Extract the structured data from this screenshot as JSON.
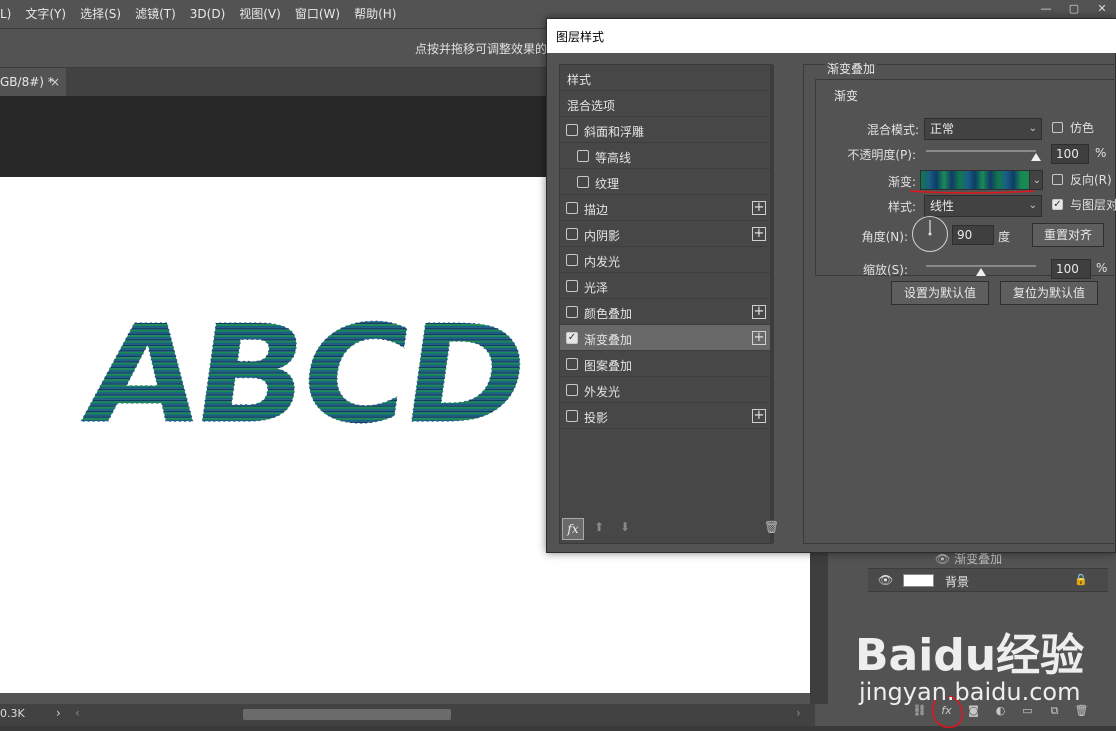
{
  "menubar": {
    "items": [
      "L)",
      "文字(Y)",
      "选择(S)",
      "滤镜(T)",
      "3D(D)",
      "视图(V)",
      "窗口(W)",
      "帮助(H)"
    ]
  },
  "options_bar": {
    "hint": "点按并拖移可调整效果的"
  },
  "document": {
    "tab_label": "GB/8#) *",
    "close_glyph": "×",
    "artwork_text": "ABCD",
    "gradient_colors": [
      "#0f7a4a",
      "#1c5f86",
      "#0b3d66",
      "#1a8a55",
      "#123a6a"
    ]
  },
  "status": {
    "zoom": "0.3K"
  },
  "layers": {
    "fx_label": "渐变叠加",
    "background_name": "背景"
  },
  "dialog": {
    "title": "图层样式",
    "style_list": {
      "header": "样式",
      "blend_options": "混合选项",
      "items": [
        {
          "label": "斜面和浮雕",
          "checked": false,
          "plus": false,
          "indent": false
        },
        {
          "label": "等高线",
          "checked": false,
          "plus": false,
          "indent": true
        },
        {
          "label": "纹理",
          "checked": false,
          "plus": false,
          "indent": true
        },
        {
          "label": "描边",
          "checked": false,
          "plus": true,
          "indent": false
        },
        {
          "label": "内阴影",
          "checked": false,
          "plus": true,
          "indent": false
        },
        {
          "label": "内发光",
          "checked": false,
          "plus": false,
          "indent": false
        },
        {
          "label": "光泽",
          "checked": false,
          "plus": false,
          "indent": false
        },
        {
          "label": "颜色叠加",
          "checked": false,
          "plus": true,
          "indent": false
        },
        {
          "label": "渐变叠加",
          "checked": true,
          "plus": true,
          "indent": false,
          "selected": true
        },
        {
          "label": "图案叠加",
          "checked": false,
          "plus": false,
          "indent": false
        },
        {
          "label": "外发光",
          "checked": false,
          "plus": false,
          "indent": false
        },
        {
          "label": "投影",
          "checked": false,
          "plus": true,
          "indent": false
        }
      ],
      "fx_glyph": "fx"
    },
    "settings": {
      "section_title": "渐变叠加",
      "group_title": "渐变",
      "blend_mode_label": "混合模式:",
      "blend_mode_value": "正常",
      "dither_label": "仿色",
      "dither_checked": false,
      "opacity_label": "不透明度(P):",
      "opacity_value": "100",
      "opacity_fraction": 1.0,
      "gradient_label": "渐变:",
      "reverse_label": "反向(R)",
      "reverse_checked": false,
      "style_label": "样式:",
      "style_value": "线性",
      "align_label": "与图层对齐",
      "align_checked": true,
      "angle_label": "角度(N):",
      "angle_value": "90",
      "angle_unit": "度",
      "reset_align_button": "重置对齐",
      "scale_label": "缩放(S):",
      "scale_value": "100",
      "scale_fraction": 0.5,
      "percent": "%",
      "make_default_button": "设置为默认值",
      "reset_default_button": "复位为默认值"
    }
  },
  "watermark": {
    "brand": "Baidu经验",
    "url": "jingyan.baidu.com"
  }
}
